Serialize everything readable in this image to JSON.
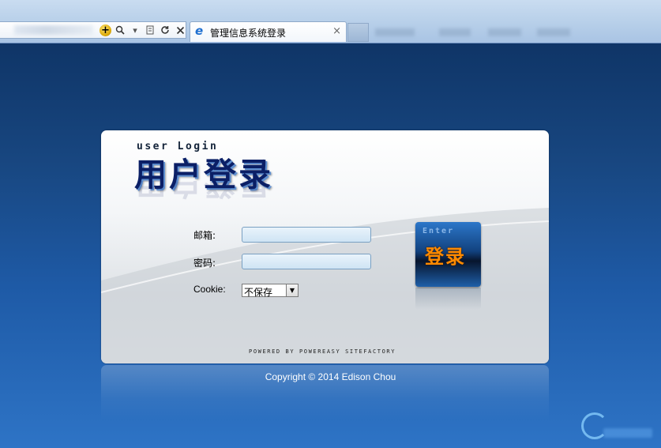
{
  "browser": {
    "tab_title": "管理信息系统登录",
    "tab_close": "×",
    "new_tab": ""
  },
  "login": {
    "header_en": "user Login",
    "header_cn": "用户登录",
    "email_label": "邮箱:",
    "email_value": "",
    "password_label": "密码:",
    "password_value": "",
    "cookie_label": "Cookie:",
    "cookie_selected": "不保存",
    "enter_button_en": "Enter",
    "enter_button_cn": "登录",
    "powered_by": "POWERED BY POWEREASY SITEFACTORY"
  },
  "footer": {
    "copyright": "Copyright © 2014 Edison Chou"
  },
  "colors": {
    "page_bg_top": "#0f3567",
    "page_bg_bottom": "#2e74c6",
    "enter_text": "#ff8a00",
    "title_blue": "#0b1f66"
  },
  "icons": [
    "add-favorite-icon",
    "search-icon",
    "compat-view-icon",
    "refresh-icon",
    "stop-icon",
    "ie-logo-icon",
    "user-icon",
    "lock-icon"
  ]
}
